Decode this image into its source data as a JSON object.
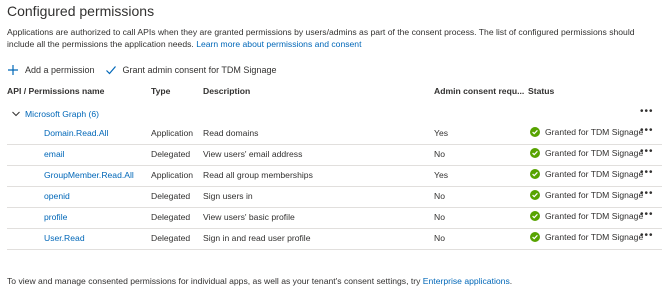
{
  "page": {
    "title": "Configured permissions",
    "description": "Applications are authorized to call APIs when they are granted permissions by users/admins as part of the consent process. The list of configured permissions should include all the permissions the application needs.",
    "learn_more": "Learn more about permissions and consent"
  },
  "toolbar": {
    "add_permission": "Add a permission",
    "grant_consent": "Grant admin consent for TDM Signage"
  },
  "table": {
    "headers": {
      "api": "API / Permissions name",
      "type": "Type",
      "description": "Description",
      "admin": "Admin consent requ...",
      "status": "Status"
    },
    "group": {
      "label": "Microsoft Graph (6)",
      "more": "•••"
    },
    "rows": [
      {
        "name": "Domain.Read.All",
        "type": "Application",
        "description": "Read domains",
        "admin": "Yes",
        "status": "Granted for TDM Signage",
        "more": "•••"
      },
      {
        "name": "email",
        "type": "Delegated",
        "description": "View users' email address",
        "admin": "No",
        "status": "Granted for TDM Signage",
        "more": "•••"
      },
      {
        "name": "GroupMember.Read.All",
        "type": "Application",
        "description": "Read all group memberships",
        "admin": "Yes",
        "status": "Granted for TDM Signage",
        "more": "•••"
      },
      {
        "name": "openid",
        "type": "Delegated",
        "description": "Sign users in",
        "admin": "No",
        "status": "Granted for TDM Signage",
        "more": "•••"
      },
      {
        "name": "profile",
        "type": "Delegated",
        "description": "View users' basic profile",
        "admin": "No",
        "status": "Granted for TDM Signage",
        "more": "•••"
      },
      {
        "name": "User.Read",
        "type": "Delegated",
        "description": "Sign in and read user profile",
        "admin": "No",
        "status": "Granted for TDM Signage",
        "more": "•••"
      }
    ]
  },
  "footer": {
    "text": "To view and manage consented permissions for individual apps, as well as your tenant's consent settings, try",
    "link": "Enterprise applications",
    "end": "."
  },
  "colors": {
    "link": "#0067b8",
    "granted": "#57a300",
    "text": "#323130",
    "divider": "#e1dfdd"
  },
  "icons": {
    "add": "plus-icon",
    "grant": "checkmark-icon",
    "expand": "chevron-down-icon",
    "status": "check-circle-icon",
    "more": "more-icon"
  }
}
